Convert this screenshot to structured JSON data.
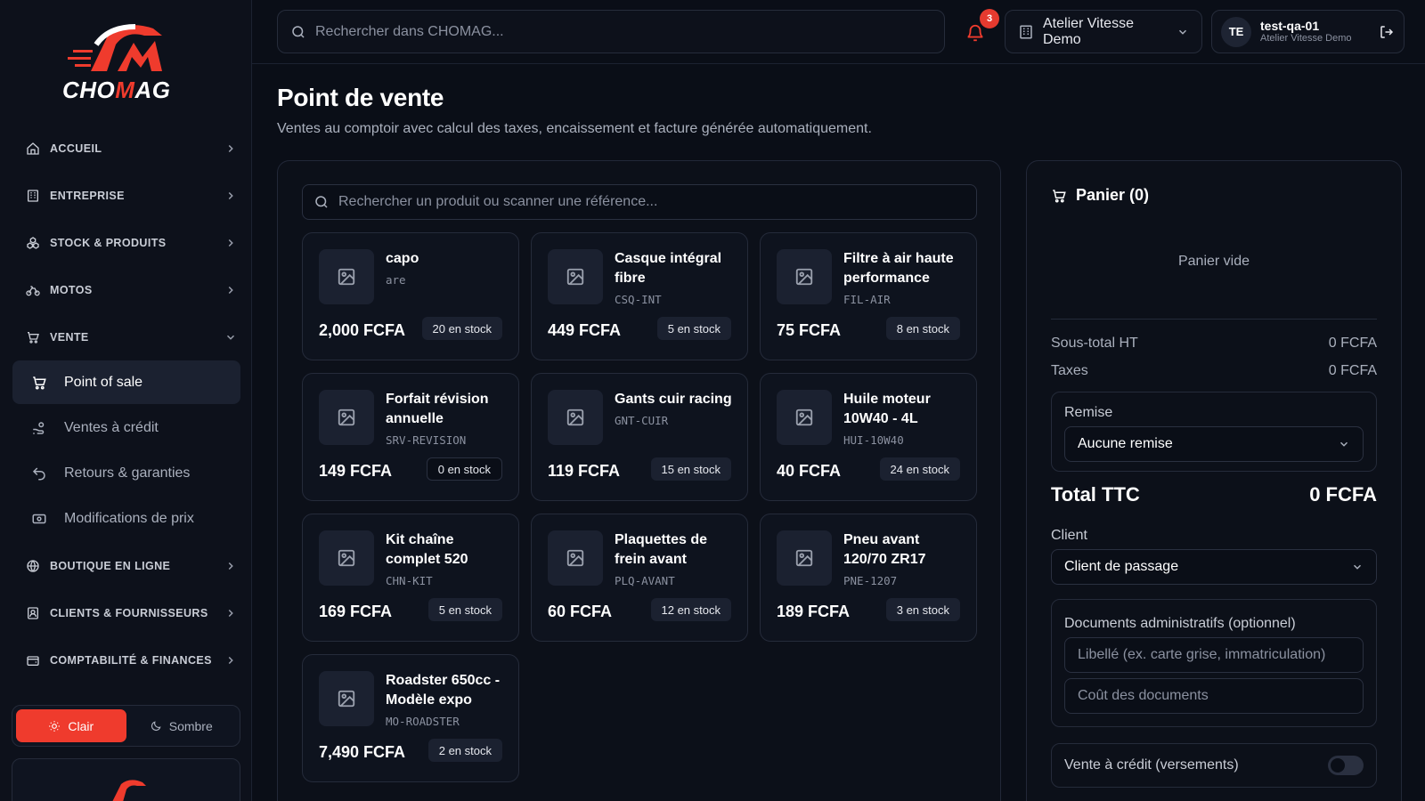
{
  "app": {
    "brand": "CHOMAG",
    "accent": "#ef3b2d"
  },
  "topbar": {
    "search_placeholder": "Rechercher dans CHOMAG...",
    "notifications_count": "3",
    "org_name": "Atelier Vitesse Demo",
    "user": {
      "initials": "TE",
      "name": "test-qa-01",
      "org": "Atelier Vitesse Demo"
    }
  },
  "sidebar": {
    "items": [
      {
        "label": "ACCUEIL",
        "icon": "home-icon"
      },
      {
        "label": "ENTREPRISE",
        "icon": "building-icon"
      },
      {
        "label": "STOCK & PRODUITS",
        "icon": "boxes-icon"
      },
      {
        "label": "MOTOS",
        "icon": "bike-icon"
      },
      {
        "label": "VENTE",
        "icon": "cart-icon",
        "expanded": true
      },
      {
        "label": "BOUTIQUE EN LIGNE",
        "icon": "globe-icon"
      },
      {
        "label": "CLIENTS & FOURNISSEURS",
        "icon": "contacts-icon"
      },
      {
        "label": "COMPTABILITÉ & FINANCES",
        "icon": "wallet-icon"
      }
    ],
    "vente_sub": [
      {
        "label": "Point of sale",
        "icon": "cart-icon",
        "active": true
      },
      {
        "label": "Ventes à crédit",
        "icon": "hand-coins-icon"
      },
      {
        "label": "Retours & garanties",
        "icon": "undo-icon"
      },
      {
        "label": "Modifications de prix",
        "icon": "price-tag-icon"
      }
    ],
    "theme": {
      "light": "Clair",
      "dark": "Sombre",
      "selected": "light"
    }
  },
  "page": {
    "title": "Point de vente",
    "subtitle": "Ventes au comptoir avec calcul des taxes, encaissement et facture générée automatiquement."
  },
  "products": {
    "search_placeholder": "Rechercher un produit ou scanner une référence...",
    "items": [
      {
        "name": "capo",
        "sku": "are",
        "price": "2,000 FCFA",
        "stock": "20 en stock"
      },
      {
        "name": "Casque intégral fibre",
        "sku": "CSQ-INT",
        "price": "449 FCFA",
        "stock": "5 en stock"
      },
      {
        "name": "Filtre à air haute performance",
        "sku": "FIL-AIR",
        "price": "75 FCFA",
        "stock": "8 en stock"
      },
      {
        "name": "Forfait révision annuelle",
        "sku": "SRV-REVISION",
        "price": "149 FCFA",
        "stock": "0 en stock"
      },
      {
        "name": "Gants cuir racing",
        "sku": "GNT-CUIR",
        "price": "119 FCFA",
        "stock": "15 en stock"
      },
      {
        "name": "Huile moteur 10W40 - 4L",
        "sku": "HUI-10W40",
        "price": "40 FCFA",
        "stock": "24 en stock"
      },
      {
        "name": "Kit chaîne complet 520",
        "sku": "CHN-KIT",
        "price": "169 FCFA",
        "stock": "5 en stock"
      },
      {
        "name": "Plaquettes de frein avant",
        "sku": "PLQ-AVANT",
        "price": "60 FCFA",
        "stock": "12 en stock"
      },
      {
        "name": "Pneu avant 120/70 ZR17",
        "sku": "PNE-1207",
        "price": "189 FCFA",
        "stock": "3 en stock"
      },
      {
        "name": "Roadster 650cc - Modèle expo",
        "sku": "MO-ROADSTER",
        "price": "7,490 FCFA",
        "stock": "2 en stock"
      }
    ]
  },
  "cart": {
    "title": "Panier (0)",
    "empty": "Panier vide",
    "subtotal_label": "Sous-total HT",
    "subtotal_value": "0 FCFA",
    "taxes_label": "Taxes",
    "taxes_value": "0 FCFA",
    "discount_label": "Remise",
    "discount_value": "Aucune remise",
    "total_label": "Total TTC",
    "total_value": "0 FCFA",
    "client_label": "Client",
    "client_value": "Client de passage",
    "docs_label": "Documents administratifs (optionnel)",
    "docs_label_placeholder": "Libellé (ex. carte grise, immatriculation)",
    "docs_cost_placeholder": "Coût des documents",
    "credit_label": "Vente à crédit (versements)"
  }
}
